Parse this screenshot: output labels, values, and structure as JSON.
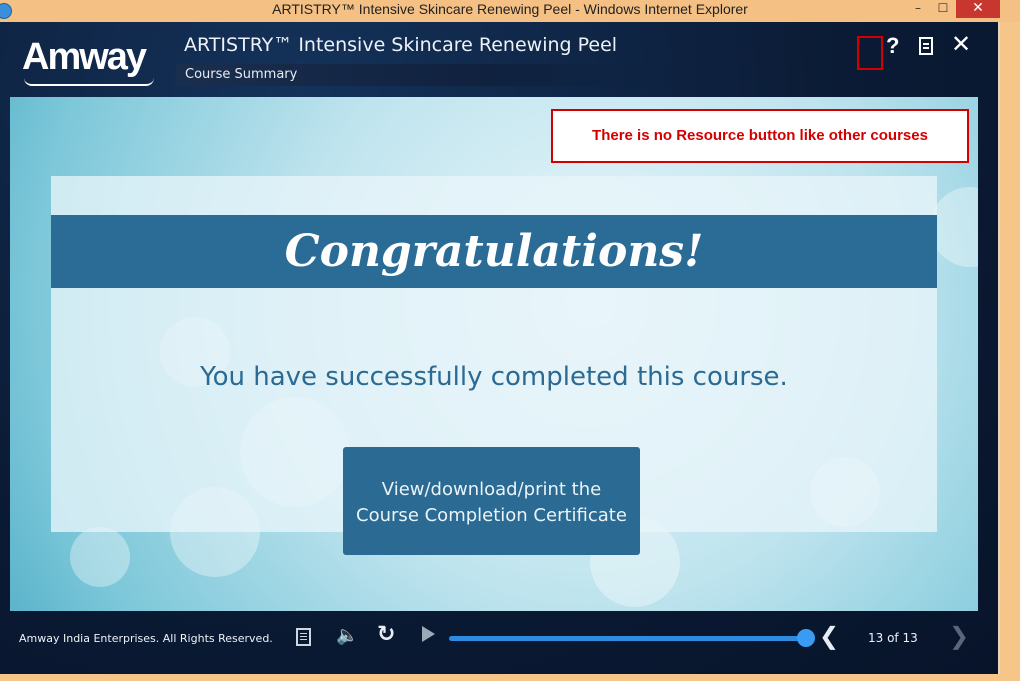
{
  "window": {
    "title": "ARTISTRY™ Intensive Skincare Renewing Peel - Windows Internet Explorer",
    "min_label": "–",
    "max_label": "☐",
    "close_label": "✕"
  },
  "header": {
    "logo": "Amway",
    "course_title": "ARTISTRY™ Intensive Skincare Renewing Peel",
    "subtitle": "Course Summary",
    "help_label": "?",
    "close_label": "✕"
  },
  "slide": {
    "heading": "Congratulations!",
    "message": "You have successfully completed this course.",
    "certificate_line1": "View/download/print the",
    "certificate_line2": "Course Completion Certificate"
  },
  "annotation": {
    "text": "There is no Resource button like other courses",
    "color": "#d40000"
  },
  "footer": {
    "copyright": "Amway India Enterprises. All Rights Reserved.",
    "page_indicator": "13 of 13",
    "progress": 1.0,
    "prev_label": "❮",
    "next_label": "❯",
    "volume_label": "🔈",
    "replay_label": "↻"
  },
  "icons": [
    "ie-icon",
    "help-icon",
    "menu-icon",
    "close-icon",
    "transcript-icon",
    "volume-icon",
    "replay-icon",
    "play-icon",
    "prev-icon",
    "next-icon"
  ],
  "colors": {
    "accent": "#2a6c95",
    "player_bg": "#0b1b35",
    "progress": "#2f8be0"
  }
}
